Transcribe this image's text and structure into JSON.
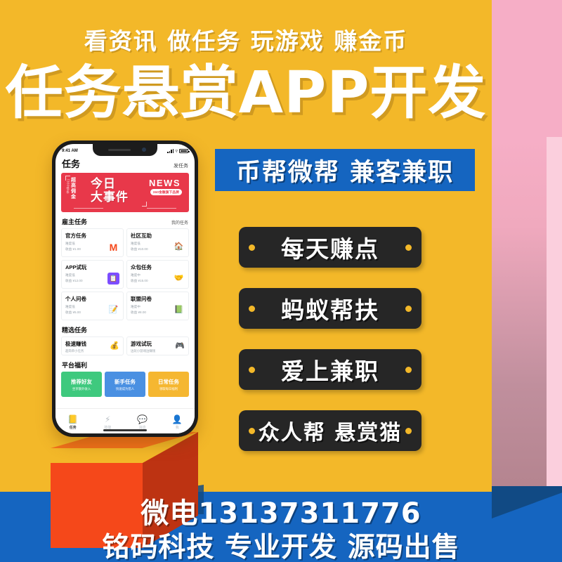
{
  "poster": {
    "kicker": "看资讯 做任务 玩游戏 赚金币",
    "headline": "任务悬赏APP开发",
    "blue_banner": "币帮微帮 兼客兼职",
    "badges": [
      "每天赚点",
      "蚂蚁帮扶",
      "爱上兼职",
      "众人帮 悬赏猫"
    ],
    "contact": {
      "phone_line": "微电13137311776",
      "company_line": "铭码科技 专业开发 源码出售"
    },
    "colors": {
      "yellow": "#f3b829",
      "blue": "#1565c0",
      "blue_dark": "#114a84",
      "pink": "#f6aec6",
      "pink_light": "#fbcfdd",
      "badge_black": "#262626",
      "badge_dot": "#f3b829",
      "cube_front": "#f5481a",
      "cube_top": "#f2711c",
      "cube_side": "#bd3312"
    }
  },
  "phone": {
    "statusbar": {
      "time": "9:41 AM",
      "signal_icon": "signal-bars-icon",
      "wifi_icon": "wifi-icon",
      "battery_icon": "battery-icon"
    },
    "header": {
      "title": "任务",
      "action": "发任务"
    },
    "news_banner": {
      "vertical_small": "「360借条",
      "vertical_big": "超高佣金",
      "main_line1": "今日",
      "main_line2": "大事件",
      "news_label": "NEWS",
      "tag": "360金融旗下品牌"
    },
    "sections": [
      {
        "title": "雇主任务",
        "more": "我的任务"
      },
      {
        "title": "精选任务",
        "more": ""
      },
      {
        "title": "平台福利",
        "more": ""
      }
    ],
    "employer_tasks": [
      {
        "name": "官方任务",
        "difficulty": "难度低",
        "pay": "收益 ¥1.00",
        "icon": "M",
        "icon_color": "#f5481a",
        "icon_bg": "transparent"
      },
      {
        "name": "社区互助",
        "difficulty": "难度低",
        "pay": "收益 ¥10.00",
        "icon": "🏠",
        "icon_color": "#2f8fe0",
        "icon_bg": "transparent"
      },
      {
        "name": "APP试玩",
        "difficulty": "难度低",
        "pay": "收益 ¥12.00",
        "icon": "📋",
        "icon_color": "#ffffff",
        "icon_bg": "#7c4dff"
      },
      {
        "name": "众包任务",
        "difficulty": "难度中",
        "pay": "收益 ¥15.00",
        "icon": "🤝",
        "icon_color": "#f5c518",
        "icon_bg": "transparent"
      },
      {
        "name": "个人问卷",
        "difficulty": "难度低",
        "pay": "收益 ¥5.00",
        "icon": "📝",
        "icon_color": "#9157ff",
        "icon_bg": "transparent"
      },
      {
        "name": "联盟问卷",
        "difficulty": "难度中",
        "pay": "收益 ¥8.00",
        "icon": "📗",
        "icon_color": "#21b573",
        "icon_bg": "transparent"
      }
    ],
    "featured_tasks": [
      {
        "name": "极速赚钱",
        "sub": "超简单小任务",
        "icon": "💰",
        "icon_color": "#f5481a"
      },
      {
        "name": "游戏试玩",
        "sub": "边玩小游戏边赚钱",
        "icon": "🎮",
        "icon_color": "#21b573"
      }
    ],
    "benefits": [
      {
        "name": "推荐好友",
        "sub": "坐享额外收入",
        "color": "#3fc97e"
      },
      {
        "name": "新手任务",
        "sub": "快速成为猎人",
        "color": "#4a90e2"
      },
      {
        "name": "日常任务",
        "sub": "领取每日福利",
        "color": "#f5b731"
      }
    ],
    "tabbar": [
      {
        "label": "任务",
        "icon": "📒",
        "active": true
      },
      {
        "label": "技能",
        "icon": "⚡",
        "active": false
      },
      {
        "label": "消息",
        "icon": "💬",
        "active": false
      },
      {
        "label": "我",
        "icon": "👤",
        "active": false
      }
    ]
  }
}
